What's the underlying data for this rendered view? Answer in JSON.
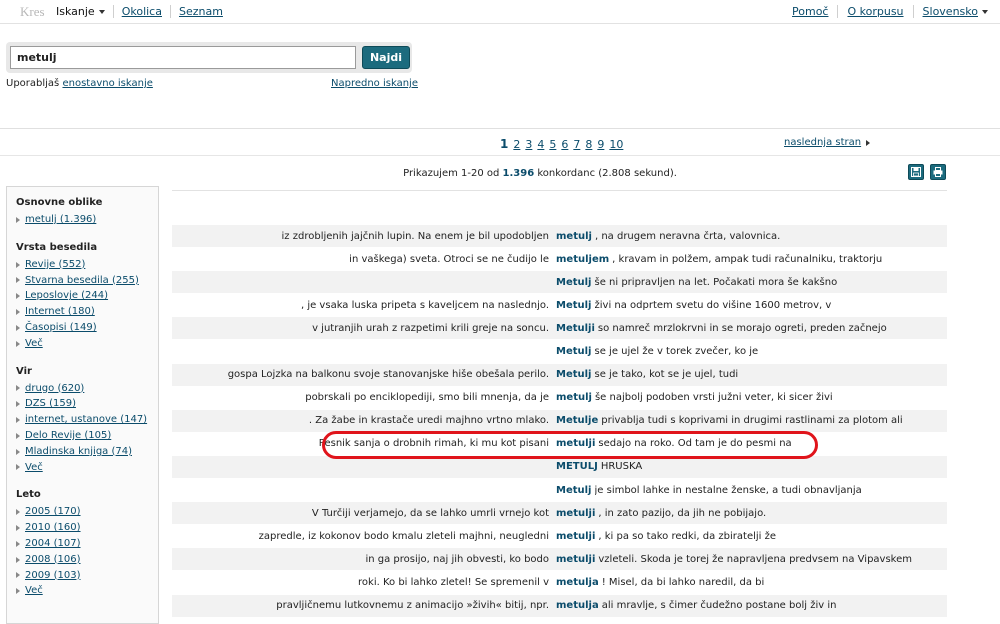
{
  "nav": {
    "brand": "Kres",
    "search_tab": "Iskanje",
    "links": [
      "Okolica",
      "Seznam"
    ],
    "help": "Pomoč",
    "about": "O korpusu",
    "language": "Slovensko"
  },
  "search": {
    "query": "metulj",
    "button": "Najdi",
    "mode_prefix": "Uporabljaš",
    "mode_link": "enostavno iskanje",
    "advanced_link": "Napredno iskanje"
  },
  "pagination": {
    "pages": [
      "1",
      "2",
      "3",
      "4",
      "5",
      "6",
      "7",
      "8",
      "9",
      "10"
    ],
    "current": "1",
    "next": "naslednja stran"
  },
  "summary": {
    "prefix": "Prikazujem 1-20 od",
    "total": "1.396",
    "suffix": "konkordanc (2.808 sekund)."
  },
  "sidebar": {
    "facets": [
      {
        "title": "Osnovne oblike",
        "items": [
          "metulj (1.396)"
        ]
      },
      {
        "title": "Vrsta besedila",
        "items": [
          "Revije (552)",
          "Stvarna besedila (255)",
          "Leposlovje (244)",
          "Internet (180)",
          "Časopisi (149)",
          "Več"
        ]
      },
      {
        "title": "Vir",
        "items": [
          "drugo (620)",
          "DZS (159)",
          "internet, ustanove (147)",
          "Delo Revije (105)",
          "Mladinska knjiga (74)",
          "Več"
        ]
      },
      {
        "title": "Leto",
        "items": [
          "2005 (170)",
          "2010 (160)",
          "2004 (107)",
          "2008 (106)",
          "2009 (103)",
          "Več"
        ]
      }
    ]
  },
  "results": [
    {
      "left": "iz zdrobljenih jajčnih lupin. Na enem je bil upodobljen",
      "kw": "metulj",
      "right": ", na drugem neravna črta, valovnica."
    },
    {
      "left": "in vaškega) sveta. Otroci se ne čudijo le",
      "kw": "metuljem",
      "right": ", kravam in polžem, ampak tudi računalniku, traktorju"
    },
    {
      "left": "",
      "kw": "Metulj",
      "right": "še ni pripravljen na let. Počakati mora še kakšno"
    },
    {
      "left": ", je vsaka luska pripeta s kaveljcem na naslednjo.",
      "kw": "Metulj",
      "right": "živi na odprtem svetu do višine 1600 metrov, v"
    },
    {
      "left": "v jutranjih urah z razpetimi krili greje na soncu.",
      "kw": "Metulji",
      "right": "so namreč mrzlokrvni in se morajo ogreti, preden začnejo"
    },
    {
      "left": "",
      "kw": "Metulj",
      "right": "se je ujel že v torek zvečer, ko je"
    },
    {
      "left": "gospa Lojzka na balkonu svoje stanovanjske hiše obešala perilo.",
      "kw": "Metulj",
      "right": "se je tako, kot se je ujel, tudi"
    },
    {
      "left": "pobrskali po enciklopediji, smo bili mnenja, da je",
      "kw": "metulj",
      "right": "še najbolj podoben vrsti južni veter, ki sicer živi"
    },
    {
      "left": ". Za žabe in krastače uredi majhno vrtno mlako.",
      "kw": "Metulje",
      "right": "privablja tudi s koprivami in drugimi rastlinami za plotom ali"
    },
    {
      "left": "Pesnik sanja o drobnih rimah, ki mu kot pisani",
      "kw": "metulji",
      "right": "sedajo na roko. Od tam je do pesmi na"
    },
    {
      "left": "",
      "kw": "METULJ",
      "right": "HRUŠKA"
    },
    {
      "left": "",
      "kw": "Metulj",
      "right": "je simbol lahke in nestalne ženske, a tudi obnavljanja"
    },
    {
      "left": "V Turčiji verjamejo, da se lahko umrli vrnejo kot",
      "kw": "metulji",
      "right": ", in zato pazijo, da jih ne pobijajo."
    },
    {
      "left": "zapredle, iz kokonov bodo kmalu zleteli majhni, neugledni",
      "kw": "metulji",
      "right": ", ki pa so tako redki, da zbiratelji že"
    },
    {
      "left": "in ga prosijo, naj jih obvesti, ko bodo",
      "kw": "metulji",
      "right": "vzleteli. Škoda je torej že napravljena predvsem na Vipavskem"
    },
    {
      "left": "roki. Ko bi lahko zletel! Se spremenil v",
      "kw": "metulja",
      "right": "! Misel, da bi lahko naredil, da bi"
    },
    {
      "left": "pravljičnemu lutkovnemu z animacijo »živih« bitij, npr.",
      "kw": "metulja",
      "right": "ali mravlje, s čimer čudežno postane bolj živ in"
    }
  ]
}
